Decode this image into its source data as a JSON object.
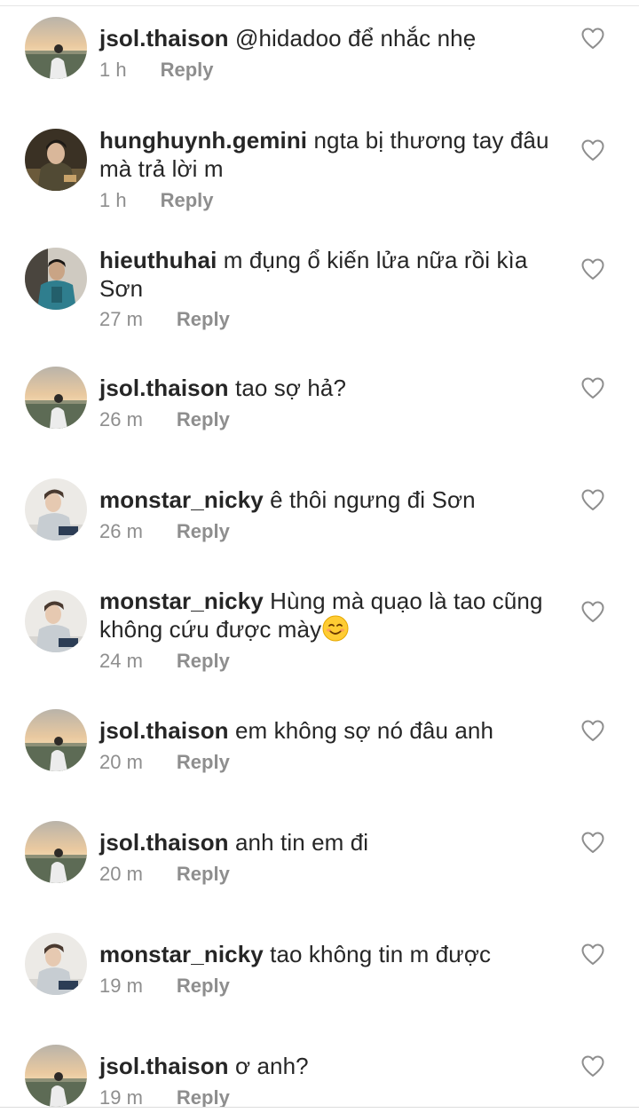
{
  "comments": [
    {
      "username": "jsol.thaison",
      "text": "@hidadoo để nhắc nhẹ",
      "time": "1 h",
      "reply_label": "Reply",
      "avatar_style": "sunset",
      "avatar_icon": "avatar-sunset-icon",
      "liked": false
    },
    {
      "username": "hunghuynh.gemini",
      "text": "ngta bị thương tay đâu mà trả lời m",
      "time": "1 h",
      "reply_label": "Reply",
      "avatar_style": "dark",
      "avatar_icon": "avatar-person-dark-icon",
      "liked": false
    },
    {
      "username": "hieuthuhai",
      "text": "m đụng ổ kiến lửa nữa rồi kìa Sơn",
      "time": "27 m",
      "reply_label": "Reply",
      "avatar_style": "teal",
      "avatar_icon": "avatar-person-teal-icon",
      "liked": false
    },
    {
      "username": "jsol.thaison",
      "text": "tao sợ hả?",
      "time": "26 m",
      "reply_label": "Reply",
      "avatar_style": "sunset",
      "avatar_icon": "avatar-sunset-icon",
      "liked": false
    },
    {
      "username": "monstar_nicky",
      "text": "ê thôi ngưng đi Sơn",
      "time": "26 m",
      "reply_label": "Reply",
      "avatar_style": "light",
      "avatar_icon": "avatar-person-light-icon",
      "liked": false
    },
    {
      "username": "monstar_nicky",
      "text": "Hùng mà quạo là tao cũng không cứu được mày",
      "emoji": "smiling-face-emoji",
      "time": "24 m",
      "reply_label": "Reply",
      "avatar_style": "light",
      "avatar_icon": "avatar-person-light-icon",
      "liked": false
    },
    {
      "username": "jsol.thaison",
      "text": "em không sợ nó đâu anh",
      "time": "20 m",
      "reply_label": "Reply",
      "avatar_style": "sunset",
      "avatar_icon": "avatar-sunset-icon",
      "liked": false
    },
    {
      "username": "jsol.thaison",
      "text": "anh tin em đi",
      "time": "20 m",
      "reply_label": "Reply",
      "avatar_style": "sunset",
      "avatar_icon": "avatar-sunset-icon",
      "liked": false
    },
    {
      "username": "monstar_nicky",
      "text": "tao không tin m được",
      "time": "19 m",
      "reply_label": "Reply",
      "avatar_style": "light",
      "avatar_icon": "avatar-person-light-icon",
      "liked": false
    },
    {
      "username": "jsol.thaison",
      "text": "ơ anh?",
      "time": "19 m",
      "reply_label": "Reply",
      "avatar_style": "sunset",
      "avatar_icon": "avatar-sunset-icon",
      "liked": false
    }
  ],
  "like_icon": "heart-outline-icon",
  "colors": {
    "text": "#262626",
    "meta": "#8e8e8e",
    "heart": "#8e8e8e",
    "background": "#ffffff"
  }
}
